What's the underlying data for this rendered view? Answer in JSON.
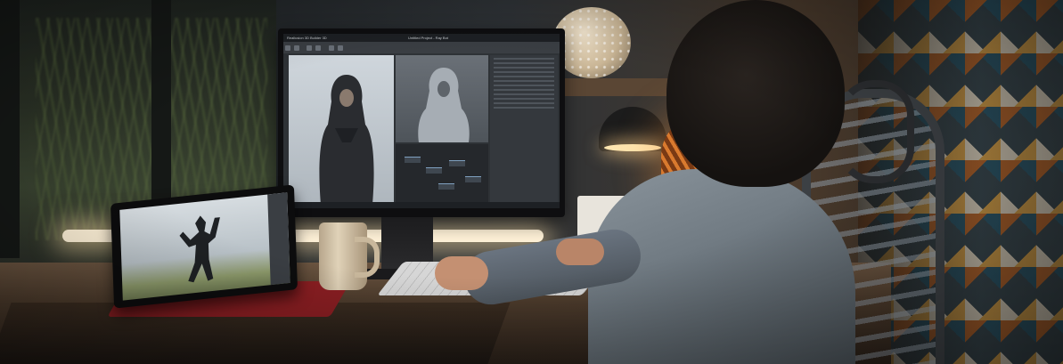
{
  "photo": {
    "subject": "person-at-desk-using-3d-software",
    "monitor": {
      "app_title": "Reallusion 3D Builder 3D",
      "project_title": "Untitled Project - Ray Bot"
    },
    "colors": {
      "accent_wall": "#b8672d",
      "monitor_ui": "#2e3236",
      "led_glow": "#fff2d8",
      "tablet_cover": "#8a1e22"
    }
  }
}
